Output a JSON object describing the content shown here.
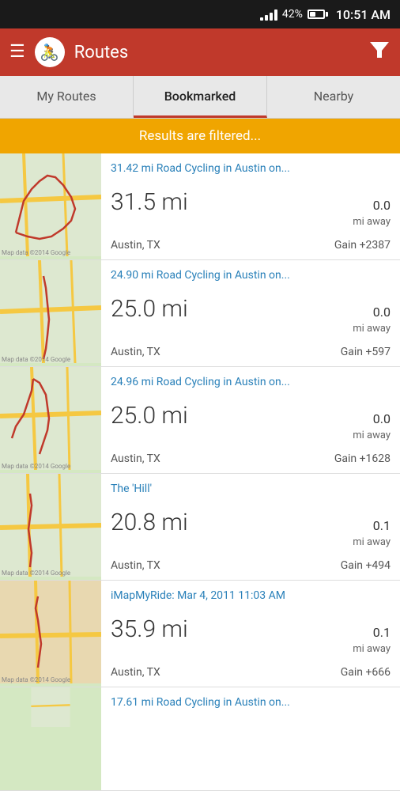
{
  "statusBar": {
    "battery": "42%",
    "time": "10:51 AM"
  },
  "header": {
    "title": "Routes",
    "menuIcon": "☰",
    "filterIcon": "▼"
  },
  "tabs": [
    {
      "id": "my-routes",
      "label": "My Routes",
      "active": false
    },
    {
      "id": "bookmarked",
      "label": "Bookmarked",
      "active": true
    },
    {
      "id": "nearby",
      "label": "Nearby",
      "active": false
    }
  ],
  "filterBanner": {
    "text": "Results are filtered..."
  },
  "routes": [
    {
      "id": 1,
      "title": "31.42 mi Road Cycling in Austin on...",
      "distance": "31.5 mi",
      "awayVal": "0.0",
      "awayLabel": "mi away",
      "location": "Austin, TX",
      "gain": "Gain +2387"
    },
    {
      "id": 2,
      "title": "24.90 mi Road Cycling in Austin on...",
      "distance": "25.0 mi",
      "awayVal": "0.0",
      "awayLabel": "mi away",
      "location": "Austin, TX",
      "gain": "Gain +597"
    },
    {
      "id": 3,
      "title": "24.96 mi Road Cycling in Austin on...",
      "distance": "25.0 mi",
      "awayVal": "0.0",
      "awayLabel": "mi away",
      "location": "Austin, TX",
      "gain": "Gain +1628"
    },
    {
      "id": 4,
      "title": "The 'Hill'",
      "distance": "20.8 mi",
      "awayVal": "0.1",
      "awayLabel": "mi away",
      "location": "Austin, TX",
      "gain": "Gain +494"
    },
    {
      "id": 5,
      "title": "iMapMyRide: Mar 4, 2011 11:03 AM",
      "distance": "35.9 mi",
      "awayVal": "0.1",
      "awayLabel": "mi away",
      "location": "Austin, TX",
      "gain": "Gain +666"
    },
    {
      "id": 6,
      "title": "17.61 mi Road Cycling in Austin on...",
      "distance": "",
      "awayVal": "",
      "awayLabel": "",
      "location": "",
      "gain": ""
    }
  ],
  "mapCopyright": "Map data ©2014 Google"
}
